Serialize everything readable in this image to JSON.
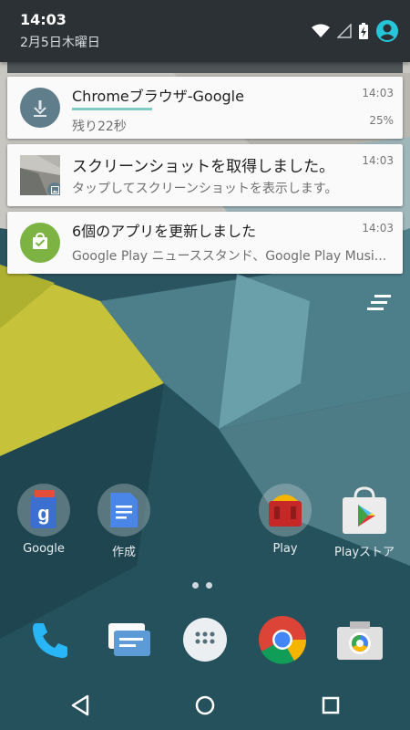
{
  "status": {
    "time": "14:03",
    "date": "2月5日木曜日",
    "icons": [
      "wifi-icon",
      "cell-signal-icon",
      "battery-charging-icon",
      "account-icon"
    ]
  },
  "notifications": [
    {
      "title": "Chromeブラウザ-Google",
      "time": "14:03",
      "subtitle": "残り22秒",
      "percent_label": "25%",
      "progress": 0.25,
      "icon": "download-icon"
    },
    {
      "title": "スクリーンショットを取得しました。",
      "time": "14:03",
      "subtitle": "タップしてスクリーンショットを表示します。",
      "icon": "screenshot-thumbnail"
    },
    {
      "title": "6個のアプリを更新しました",
      "time": "14:03",
      "subtitle": "Google Play ニューススタンド、Google Play Musi...",
      "icon": "play-store-update-icon"
    }
  ],
  "home": {
    "apps": [
      {
        "label": "Google",
        "icon": "google-folder-icon"
      },
      {
        "label": "作成",
        "icon": "create-folder-icon"
      },
      {
        "label": "Play",
        "icon": "play-folder-icon"
      },
      {
        "label": "Playストア",
        "icon": "play-store-icon"
      }
    ],
    "dock": [
      "phone-icon",
      "messaging-icon",
      "app-drawer-icon",
      "chrome-icon",
      "camera-icon"
    ]
  },
  "nav": [
    "back-icon",
    "home-icon",
    "recents-icon"
  ],
  "colors": {
    "header_bg": "#2c3135",
    "notification_bg": "#fafafa",
    "progress": "#80cbc4",
    "account_accent": "#26c6da",
    "update_green": "#7cb342"
  }
}
